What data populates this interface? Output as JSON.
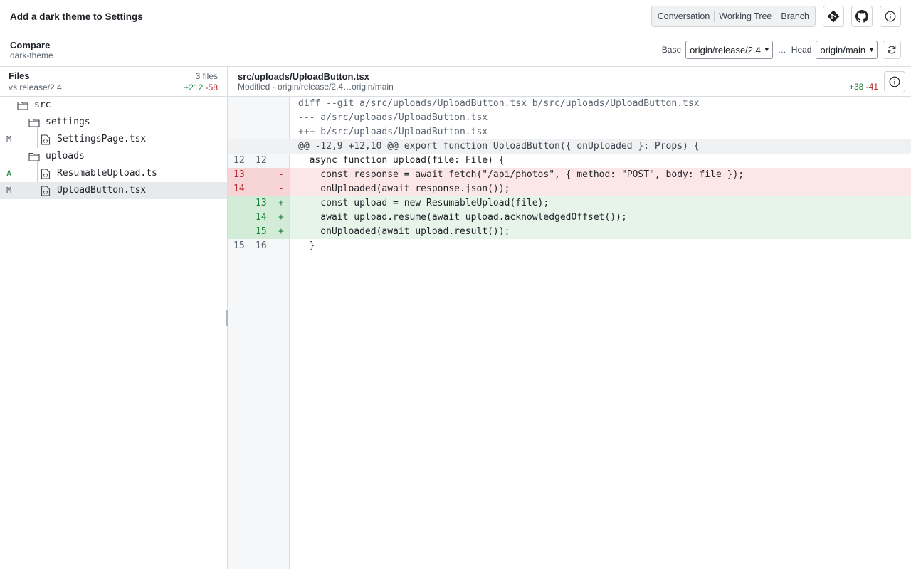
{
  "header": {
    "title": "Add a dark theme to Settings",
    "tabs": [
      "Conversation",
      "Working Tree",
      "Branch"
    ],
    "icons": [
      "git-icon",
      "github-icon",
      "info-icon"
    ]
  },
  "compare": {
    "title": "Compare",
    "branch": "dark-theme",
    "base_label": "Base",
    "base_value": "origin/release/2.4",
    "separator": "…",
    "head_label": "Head",
    "head_value": "origin/main"
  },
  "files": {
    "title": "Files",
    "subtitle": "vs release/2.4",
    "count": "3 files",
    "additions": "+212",
    "deletions": "-58",
    "tree": [
      {
        "name": "src",
        "type": "folder",
        "status": ""
      },
      {
        "name": "settings",
        "type": "folder",
        "status": ""
      },
      {
        "name": "SettingsPage.tsx",
        "type": "file",
        "status": "M"
      },
      {
        "name": "uploads",
        "type": "folder",
        "status": ""
      },
      {
        "name": "ResumableUpload.ts",
        "type": "file",
        "status": "A"
      },
      {
        "name": "UploadButton.tsx",
        "type": "file",
        "status": "M"
      }
    ]
  },
  "diff": {
    "path": "src/uploads/UploadButton.tsx",
    "meta": "Modified · origin/release/2.4…origin/main",
    "additions": "+38",
    "deletions": "-41",
    "lines": [
      {
        "kind": "meta",
        "old": "",
        "new": "",
        "marker": "",
        "text": "diff --git a/src/uploads/UploadButton.tsx b/src/uploads/UploadButton.tsx"
      },
      {
        "kind": "meta",
        "old": "",
        "new": "",
        "marker": "",
        "text": "--- a/src/uploads/UploadButton.tsx"
      },
      {
        "kind": "meta",
        "old": "",
        "new": "",
        "marker": "",
        "text": "+++ b/src/uploads/UploadButton.tsx"
      },
      {
        "kind": "hunk",
        "old": "",
        "new": "",
        "marker": "",
        "text": "@@ -12,9 +12,10 @@ export function UploadButton({ onUploaded }: Props) {"
      },
      {
        "kind": "ctx",
        "old": "12",
        "new": "12",
        "marker": "",
        "text": "  async function upload(file: File) {"
      },
      {
        "kind": "del",
        "old": "13",
        "new": "",
        "marker": "-",
        "text": "    const response = await fetch(\"/api/photos\", { method: \"POST\", body: file });"
      },
      {
        "kind": "del",
        "old": "14",
        "new": "",
        "marker": "-",
        "text": "    onUploaded(await response.json());"
      },
      {
        "kind": "add",
        "old": "",
        "new": "13",
        "marker": "+",
        "text": "    const upload = new ResumableUpload(file);"
      },
      {
        "kind": "add",
        "old": "",
        "new": "14",
        "marker": "+",
        "text": "    await upload.resume(await upload.acknowledgedOffset());"
      },
      {
        "kind": "add",
        "old": "",
        "new": "15",
        "marker": "+",
        "text": "    onUploaded(await upload.result());"
      },
      {
        "kind": "ctx",
        "old": "15",
        "new": "16",
        "marker": "",
        "text": "  }"
      }
    ]
  }
}
